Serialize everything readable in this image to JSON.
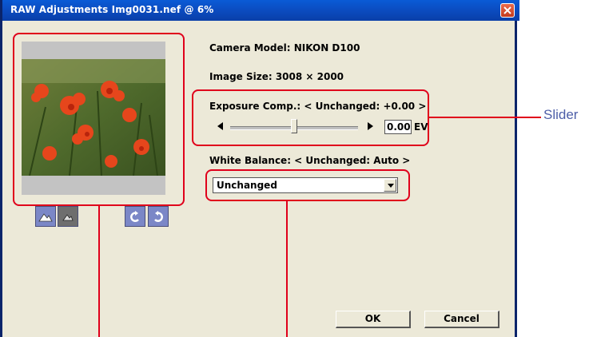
{
  "window": {
    "title": "RAW Adjustments Img0031.nef @ 6%"
  },
  "info": {
    "camera_model": "Camera Model: NIKON D100",
    "image_size": "Image Size: 3008 × 2000"
  },
  "exposure": {
    "label": "Exposure Comp.: < Unchanged: +0.00 >",
    "value": "0.00",
    "unit": "EV",
    "slider_level": 0.5
  },
  "white_balance": {
    "label": "White Balance: < Unchanged: Auto >",
    "selected": "Unchanged"
  },
  "buttons": {
    "ok": "OK",
    "cancel": "Cancel"
  },
  "annotations": {
    "slider_label": "Slider"
  },
  "colors": {
    "title_bar": "#0b4dc2",
    "callout": "#e0001b",
    "annotation_text": "#4d5ea8"
  }
}
